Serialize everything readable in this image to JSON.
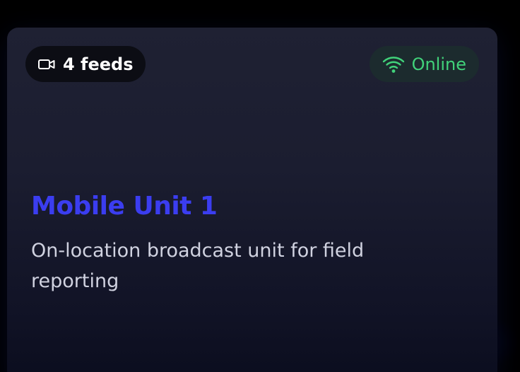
{
  "card": {
    "feeds_label": "4 feeds",
    "feeds_icon": "video-camera-icon",
    "status_label": "Online",
    "status_icon": "wifi-icon",
    "title": "Mobile Unit 1",
    "description": "On-location broadcast unit for field reporting"
  },
  "colors": {
    "title": "#3b3df0",
    "status_text": "#41d27a",
    "status_bg": "#1c2b2e",
    "card_bg": "#1f2133"
  }
}
